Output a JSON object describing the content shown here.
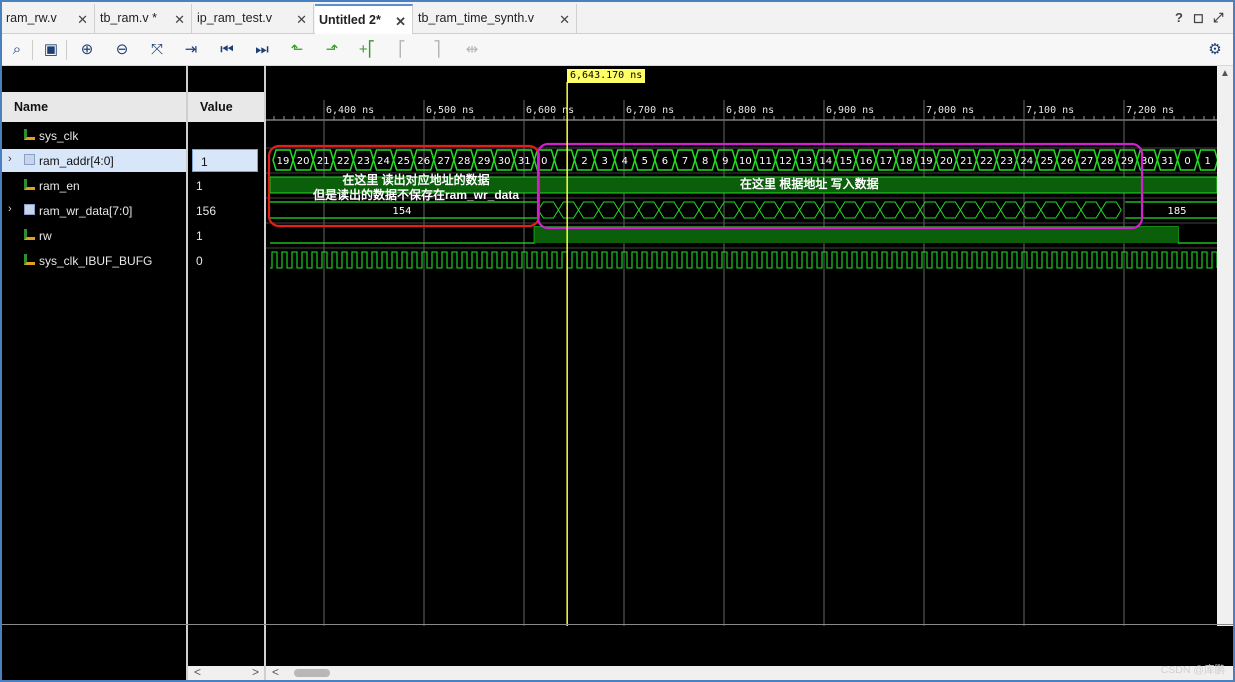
{
  "tabs": [
    {
      "label": "ram_rw.v",
      "active": false
    },
    {
      "label": "tb_ram.v *",
      "active": false
    },
    {
      "label": "ip_ram_test.v",
      "active": false
    },
    {
      "label": "Untitled 2*",
      "active": true
    },
    {
      "label": "tb_ram_time_synth.v",
      "active": false
    }
  ],
  "window_controls": {
    "help": "?",
    "restore": "◻",
    "maximize": "⤢"
  },
  "toolbar": {
    "icons": [
      "search-icon",
      "save-icon",
      "zoom-in-icon",
      "zoom-out-icon",
      "zoom-fit-icon",
      "go-to-cursor-icon",
      "go-to-start-icon",
      "go-to-end-icon",
      "previous-transition-icon",
      "next-transition-icon",
      "add-marker-icon",
      "previous-marker-icon",
      "next-marker-icon",
      "swap-cursors-icon",
      "settings-icon"
    ]
  },
  "columns": {
    "name": "Name",
    "value": "Value"
  },
  "signals": [
    {
      "name": "sys_clk",
      "value": "",
      "icon": "bit-icon",
      "expandable": false,
      "selected": false
    },
    {
      "name": "ram_addr[4:0]",
      "value": "1",
      "icon": "bus-icon",
      "expandable": true,
      "selected": true
    },
    {
      "name": "ram_en",
      "value": "1",
      "icon": "bit-icon",
      "expandable": false,
      "selected": false
    },
    {
      "name": "ram_wr_data[7:0]",
      "value": "156",
      "icon": "bus-icon",
      "expandable": true,
      "selected": false
    },
    {
      "name": "rw",
      "value": "1",
      "icon": "bit-icon",
      "expandable": false,
      "selected": false
    },
    {
      "name": "sys_clk_IBUF_BUFG",
      "value": "0",
      "icon": "bit-icon",
      "expandable": false,
      "selected": false
    }
  ],
  "cursor": {
    "label": "6,643.170 ns",
    "time_ns": 6643.17
  },
  "timeline": {
    "ticks": [
      "6,400 ns",
      "6,500 ns",
      "6,600 ns",
      "6,700 ns",
      "6,800 ns",
      "6,900 ns",
      "7,000 ns",
      "7,100 ns",
      "7,200 ns"
    ],
    "tick_times_ns": [
      6400,
      6500,
      6600,
      6700,
      6800,
      6900,
      7000,
      7100,
      7200
    ]
  },
  "waveform": {
    "addr_read": [
      "19",
      "20",
      "21",
      "22",
      "23",
      "24",
      "25",
      "26",
      "27",
      "28",
      "29",
      "30",
      "31"
    ],
    "addr_write": [
      "0",
      "",
      "2",
      "3",
      "4",
      "5",
      "6",
      "7",
      "8",
      "9",
      "10",
      "11",
      "12",
      "13",
      "14",
      "15",
      "16",
      "17",
      "18",
      "19",
      "20",
      "21",
      "22",
      "23",
      "24",
      "25",
      "26",
      "27",
      "28",
      "29",
      "30",
      "31",
      "0",
      "1"
    ],
    "data_read_value": "154",
    "data_after_value": "185"
  },
  "annotations": {
    "read_line1": "在这里 读出对应地址的数据",
    "read_line2": "但是读出的数据不保存在ram_wr_data",
    "write_line": "在这里 根据地址 写入数据",
    "read_box_color": "#e0201a",
    "write_box_color": "#d020d0"
  },
  "watermark": "CSDN @库鹏",
  "colors": {
    "wave_green": "#22dd22",
    "enable_fill": "#0b5f0b",
    "cursor": "#ffff44",
    "selection": "#d7e6f8"
  }
}
